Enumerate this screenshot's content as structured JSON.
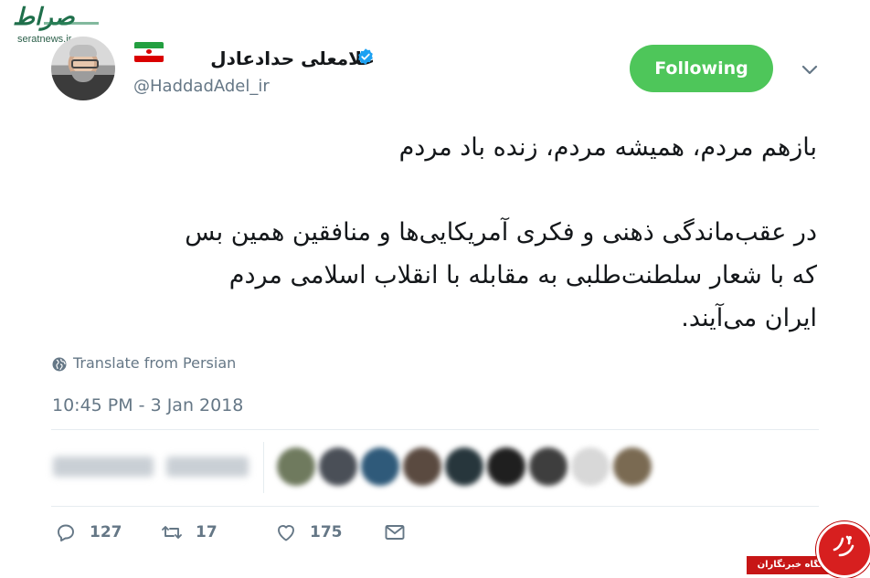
{
  "watermark_top": {
    "logo_text": "صراط",
    "url": "seratnews.ir"
  },
  "author": {
    "display_name": "غلامعلی حدادعادل",
    "handle": "@HaddadAdel_ir",
    "verified": true,
    "flag_colors": [
      "#239f40",
      "#ffffff",
      "#da0000"
    ]
  },
  "follow_button": {
    "label": "Following",
    "color": "#4ec65a"
  },
  "tweet": {
    "lines_block1": [
      "بازهم مردم، همیشه مردم، زنده باد مردم"
    ],
    "lines_block2": [
      "در عقب‌ماندگی ذهنی و فکری آمریکایی‌ها و منافقین همین بس",
      "که با شعار سلطنت‌طلبی به مقابله با انقلاب اسلامی مردم",
      "ایران می‌آیند."
    ]
  },
  "translate_label": "Translate from Persian",
  "timestamp": "10:45 PM - 3 Jan 2018",
  "actions": {
    "replies": "127",
    "retweets": "17",
    "likes": "175"
  },
  "watermark_bottom": {
    "label": "باشگاه خبرنگاران",
    "icon": "khabarfori-logo-icon"
  },
  "icons": {
    "verified": "verified-badge-icon",
    "chevron": "chevron-down-icon",
    "globe": "globe-icon",
    "reply": "reply-icon",
    "retweet": "retweet-icon",
    "like": "heart-icon",
    "dm": "envelope-icon"
  },
  "colors": {
    "secondary_text": "#657786",
    "verified_blue": "#1da1f2",
    "separator": "#e6ecf0"
  }
}
